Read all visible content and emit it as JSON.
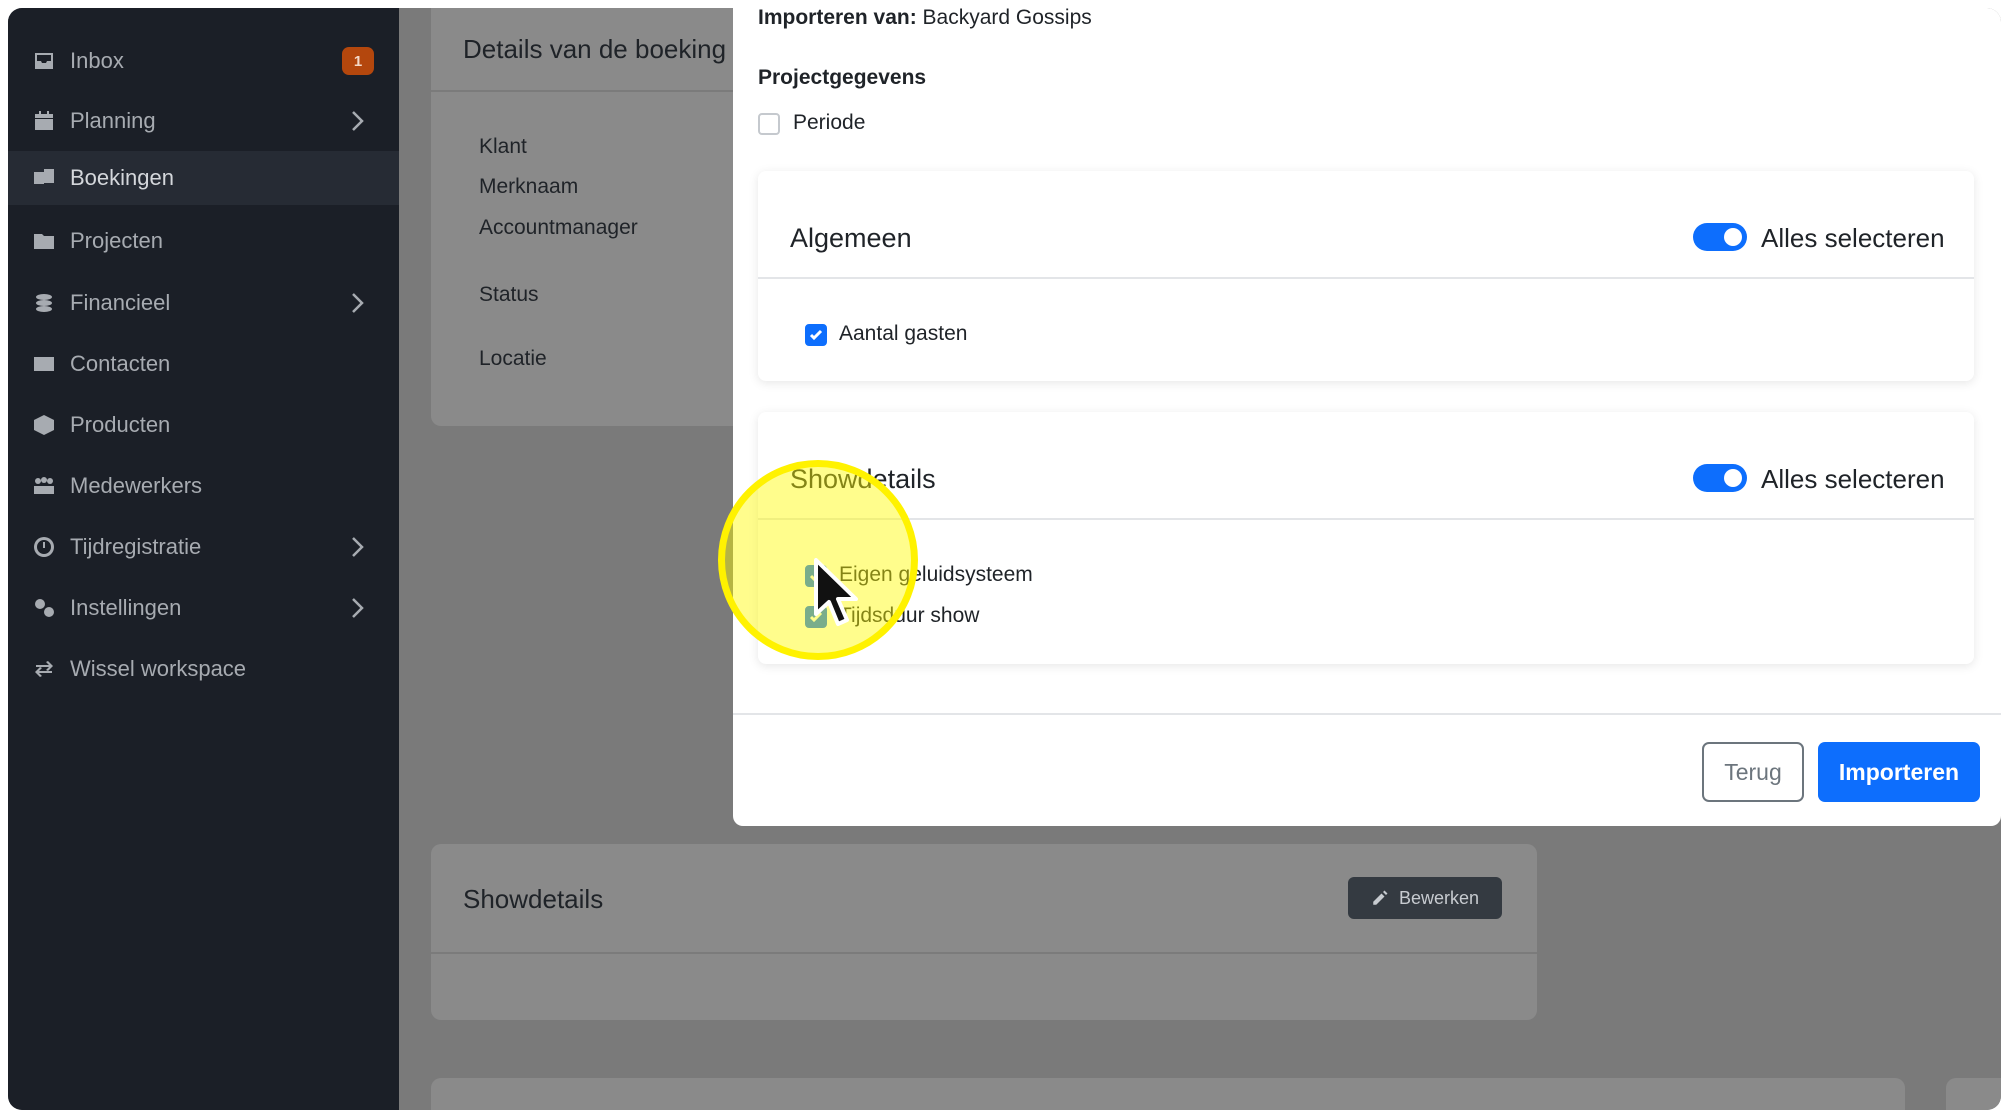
{
  "sidebar": {
    "items": [
      {
        "label": "Inbox",
        "icon": "inbox-icon",
        "badge": "1"
      },
      {
        "label": "Planning",
        "icon": "calendar-icon",
        "chevron": true
      },
      {
        "label": "Boekingen",
        "icon": "bookings-icon",
        "active": true
      },
      {
        "label": "Projecten",
        "icon": "folder-icon"
      },
      {
        "label": "Financieel",
        "icon": "coins-icon",
        "chevron": true
      },
      {
        "label": "Contacten",
        "icon": "contact-card-icon"
      },
      {
        "label": "Producten",
        "icon": "box-icon"
      },
      {
        "label": "Medewerkers",
        "icon": "people-icon"
      },
      {
        "label": "Tijdregistratie",
        "icon": "clock-icon",
        "chevron": true
      },
      {
        "label": "Instellingen",
        "icon": "gears-icon",
        "chevron": true
      },
      {
        "label": "Wissel workspace",
        "icon": "switch-icon"
      }
    ]
  },
  "background": {
    "details_card": {
      "title": "Details van de boeking",
      "fields": [
        "Klant",
        "Merknaam",
        "Accountmanager",
        "Status",
        "Locatie"
      ]
    },
    "showdetails_card": {
      "title": "Showdetails",
      "edit_label": "Bewerken"
    }
  },
  "modal": {
    "import_from_label": "Importeren van:",
    "import_from_value": "Backyard Gossips",
    "project_heading": "Projectgegevens",
    "period": {
      "label": "Periode",
      "checked": false
    },
    "sections": [
      {
        "title": "Algemeen",
        "toggle_label": "Alles selecteren",
        "toggle_on": true,
        "options": [
          {
            "label": "Aantal gasten",
            "checked": true
          }
        ]
      },
      {
        "title": "Showdetails",
        "toggle_label": "Alles selecteren",
        "toggle_on": true,
        "options": [
          {
            "label": "Eigen geluidsysteem",
            "checked": true
          },
          {
            "label": "Tijdsduur show",
            "checked": true
          }
        ]
      }
    ],
    "back_label": "Terug",
    "import_label": "Importeren"
  },
  "colors": {
    "sidebar_bg": "#1b1f27",
    "primary": "#0d6efd",
    "badge": "#b4470d",
    "highlight": "#fff200"
  }
}
